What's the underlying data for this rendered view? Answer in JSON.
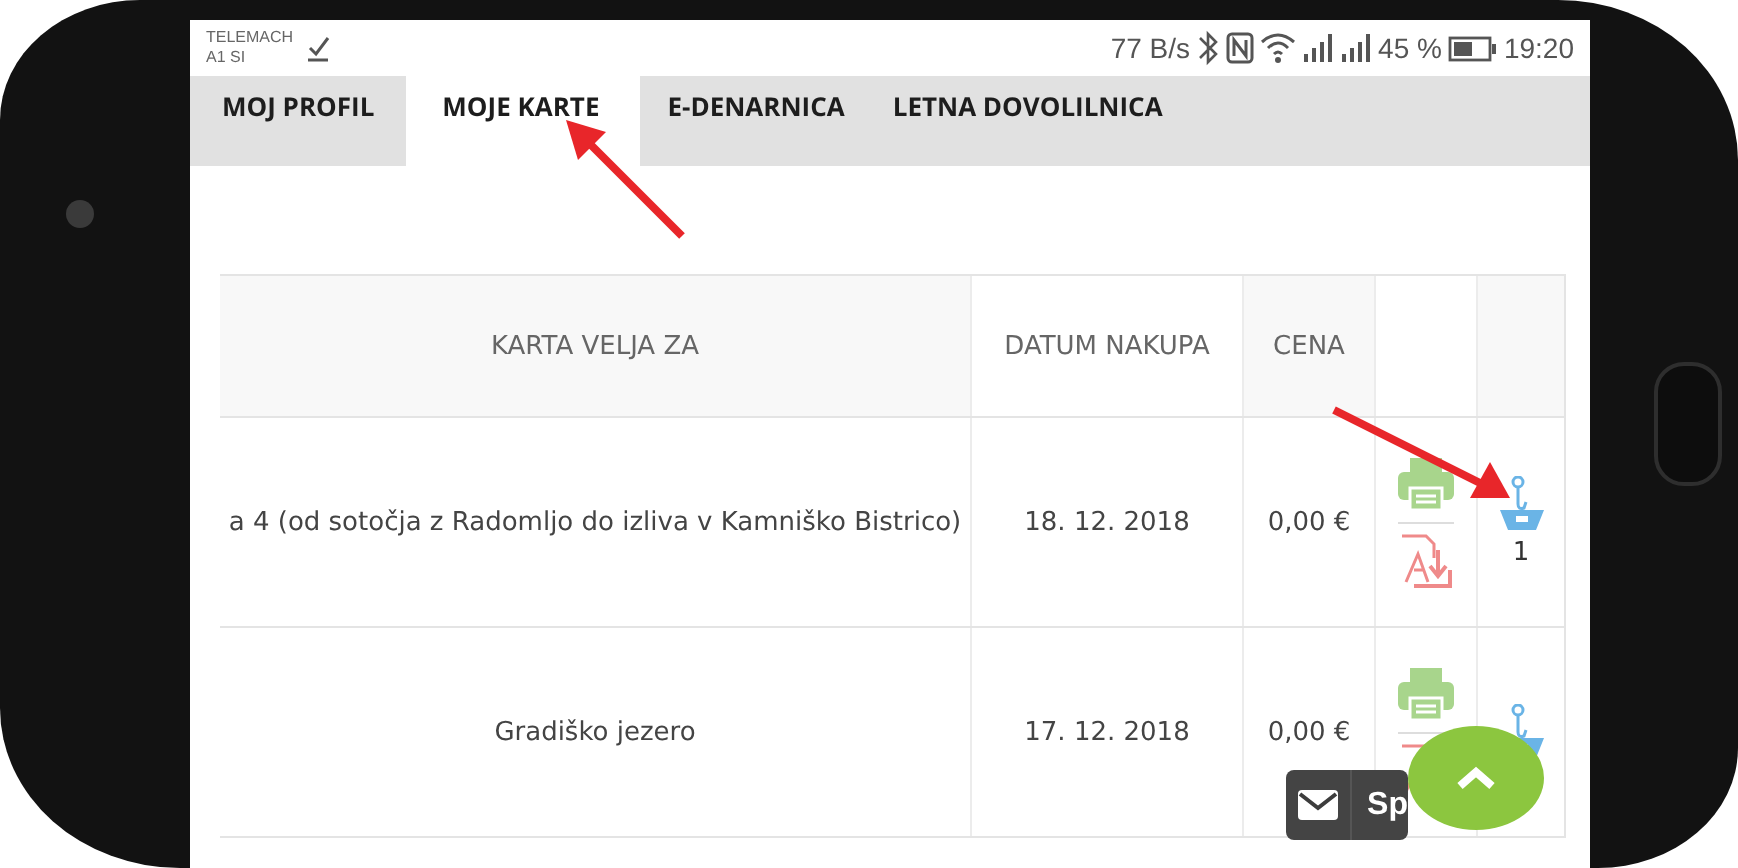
{
  "status_bar": {
    "carrier": "TELEMACH",
    "carrier_secondary": "A1 SI",
    "speed": "77 B/s",
    "battery": "45 %",
    "time": "19:20"
  },
  "tabs": [
    {
      "label": "MOJ PROFIL",
      "selected": false
    },
    {
      "label": "MOJE KARTE",
      "selected": true
    },
    {
      "label": "E-DENARNICA",
      "selected": false
    },
    {
      "label": "LETNA DOVOLILNICA",
      "selected": false
    }
  ],
  "table": {
    "columns": [
      "KARTA VELJA ZA",
      "DATUM NAKUPA",
      "CENA"
    ],
    "rows": [
      {
        "ticket": "a 4 (od sotočja z Radomljo do izliva v Kamniško Bistrico)",
        "date": "18. 12. 2018",
        "price": "0,00 €",
        "count": "1"
      },
      {
        "ticket": "Gradiško jezero",
        "date": "17. 12. 2018",
        "price": "0,00 €"
      }
    ]
  },
  "feedback_button": {
    "label": "Sp"
  }
}
